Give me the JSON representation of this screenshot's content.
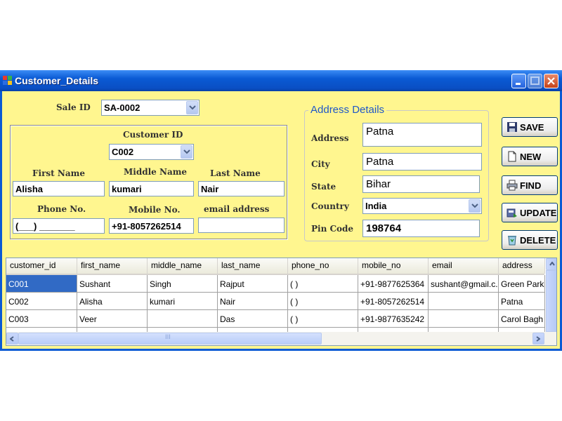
{
  "window": {
    "title": "Customer_Details"
  },
  "sale": {
    "label": "Sale ID",
    "value": "SA-0002"
  },
  "customer": {
    "id_label": "Customer ID",
    "id_value": "C002",
    "first_label": "First Name",
    "first_value": "Alisha",
    "middle_label": "Middle Name",
    "middle_value": "kumari",
    "last_label": "Last Name",
    "last_value": "Nair",
    "phone_label": "Phone No.",
    "phone_value": "(___) _______",
    "mobile_label": "Mobile No.",
    "mobile_value": "+91-8057262514",
    "email_label": "email address",
    "email_value": ""
  },
  "address": {
    "group_title": "Address Details",
    "address_label": "Address",
    "address_value": "Patna",
    "city_label": "City",
    "city_value": "Patna",
    "state_label": "State",
    "state_value": "Bihar",
    "country_label": "Country",
    "country_value": "India",
    "pin_label": "Pin Code",
    "pin_value": "198764"
  },
  "buttons": {
    "save": "SAVE",
    "new": "NEW",
    "find": "FIND",
    "update": "UPDATE",
    "delete": "DELETE"
  },
  "grid": {
    "columns": [
      "customer_id",
      "first_name",
      "middle_name",
      "last_name",
      "phone_no",
      "mobile_no",
      "email",
      "address"
    ],
    "rows": [
      [
        "C001",
        "Sushant",
        "Singh",
        "Rajput",
        "(   )",
        "+91-9877625364",
        "sushant@gmail.c...",
        "Green Park"
      ],
      [
        "C002",
        "Alisha",
        "kumari",
        "Nair",
        "(   )",
        "+91-8057262514",
        "",
        "Patna"
      ],
      [
        "C003",
        "Veer",
        "",
        "Das",
        "(   )",
        "+91-9877635242",
        "",
        "Carol Bagh"
      ]
    ],
    "scroll_mark": "III"
  }
}
